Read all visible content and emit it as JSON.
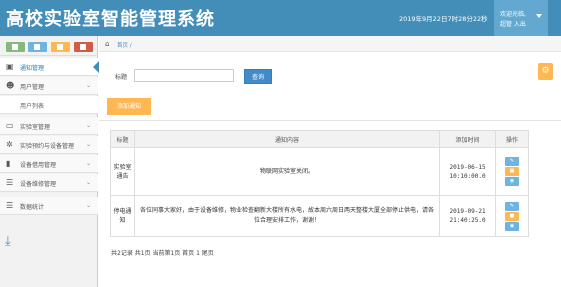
{
  "header": {
    "title": "高校实验室智能管理系统",
    "clock": "2019年9月22日7时28分22秒",
    "user_line1": "欢迎光临,",
    "user_line2": "超管 入出"
  },
  "sidebar": {
    "shortcut_icons": [
      "chart-icon",
      "pencil-icon",
      "users-icon",
      "cogs-icon"
    ],
    "items": [
      {
        "label": "通知管理",
        "icon": "monitor-icon",
        "active": true
      },
      {
        "label": "用户管理",
        "icon": "users-icon",
        "expanded": true
      },
      {
        "label": "用户列表",
        "icon": "",
        "sub": true
      },
      {
        "label": "实验室管理",
        "icon": "desktop-icon"
      },
      {
        "label": "实验预约与设备管理",
        "icon": "cogs-icon"
      },
      {
        "label": "设备借用管理",
        "icon": "bookmark-icon"
      },
      {
        "label": "设备维修管理",
        "icon": "list-icon"
      },
      {
        "label": "数据统计",
        "icon": "list-icon"
      }
    ],
    "collapse_icon": "download-icon"
  },
  "breadcrumb": {
    "home_icon": "home-icon",
    "crumb": "首页 /"
  },
  "search": {
    "label": "标题",
    "value": "",
    "placeholder": "",
    "button": "查询"
  },
  "toolbar": {
    "add_label": "添加通知",
    "settings_icon": "gear-icon"
  },
  "table": {
    "headers": [
      "标题",
      "通知内容",
      "添加时间",
      "操作"
    ],
    "rows": [
      {
        "title": "实验室通告",
        "content": "物联网实验室关闭。",
        "time": "2019-06-15 10:10:00.0"
      },
      {
        "title": "停电通知",
        "content": "各位同事大家好，由于设备维修，物业检查翻新大楼所有水电，故本周六周日两天整楼大厦全部停止供电，请各位合理安排工作，谢谢！",
        "time": "2019-09-21 21:40:25.0"
      }
    ],
    "op_icons": [
      "edit-icon",
      "trash-icon",
      "eye-icon"
    ]
  },
  "pager": {
    "text": "共2记录 共1页 当前第1页 首页 1 尾页"
  },
  "colors": {
    "header_bg": "#438eb9",
    "user_bg": "#62a8d1",
    "primary": "#428bca",
    "warning": "#ffb752",
    "info": "#6fb3e0"
  }
}
